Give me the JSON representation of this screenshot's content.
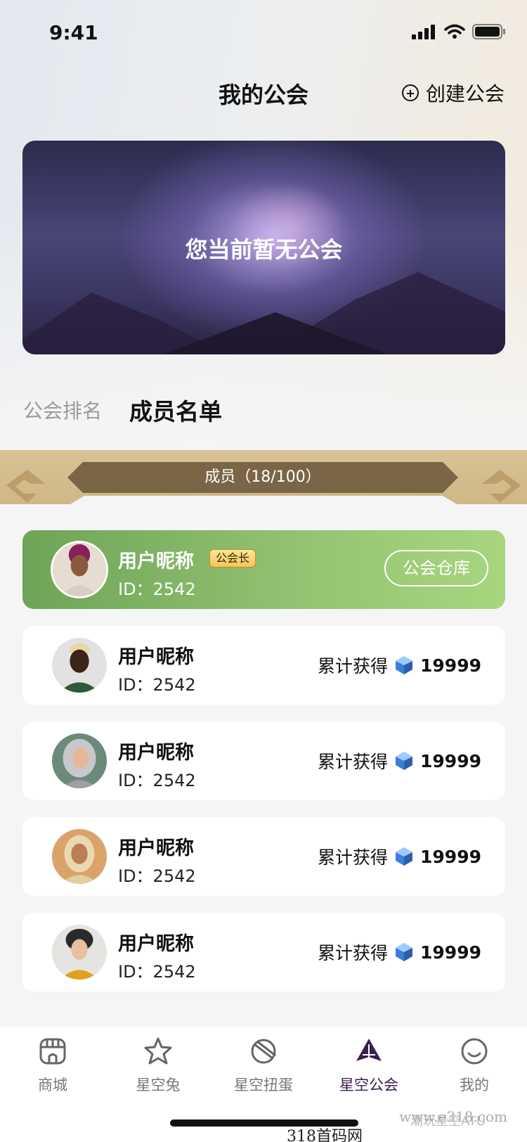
{
  "status_bar": {
    "time": "9:41"
  },
  "header": {
    "title": "我的公会",
    "create_label": "创建公会"
  },
  "banner": {
    "text": "您当前暂无公会"
  },
  "tabs": [
    {
      "label": "公会排名"
    },
    {
      "label": "成员名单"
    }
  ],
  "members_header": {
    "label": "成员（18/100）"
  },
  "leader_card": {
    "name": "用户昵称",
    "id": "ID：2542",
    "badge": "公会长",
    "button": "公会仓库"
  },
  "members": [
    {
      "name": "用户昵称",
      "id": "ID：2542",
      "earn_label": "累计获得",
      "earn_value": "19999"
    },
    {
      "name": "用户昵称",
      "id": "ID：2542",
      "earn_label": "累计获得",
      "earn_value": "19999"
    },
    {
      "name": "用户昵称",
      "id": "ID：2542",
      "earn_label": "累计获得",
      "earn_value": "19999"
    },
    {
      "name": "用户昵称",
      "id": "ID：2542",
      "earn_label": "累计获得",
      "earn_value": "19999"
    }
  ],
  "tabbar": [
    {
      "label": "商城",
      "icon": "store-icon"
    },
    {
      "label": "星空兔",
      "icon": "star-icon"
    },
    {
      "label": "星空扭蛋",
      "icon": "capsule-icon"
    },
    {
      "label": "星空公会",
      "icon": "guild-icon",
      "active": true
    },
    {
      "label": "我的",
      "icon": "smile-icon"
    }
  ],
  "watermarks": {
    "right": "www.e318.com",
    "left": "潮玩星空ATU",
    "bottom": "318首码网"
  },
  "colors": {
    "accent": "#3a1e4e",
    "leader_green": "#8cbe6a",
    "band": "#d8c296",
    "pill": "#7a6546"
  }
}
